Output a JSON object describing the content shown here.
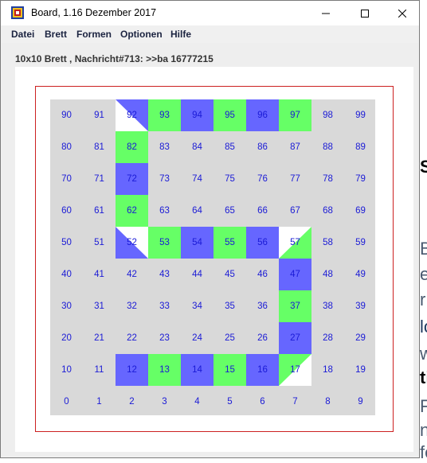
{
  "window": {
    "title": "Board, 1.16 Dezember 2017",
    "controls": {
      "minimize": "minimize",
      "maximize": "maximize",
      "close": "close"
    }
  },
  "menu": [
    "Datei",
    "Brett",
    "Formen",
    "Optionen",
    "Hilfe"
  ],
  "message": "10x10 Brett , Nachricht#713: >>ba 16777215",
  "board": {
    "size": 10,
    "colors": {
      "base": "#d9d9d9",
      "green": "#66ff66",
      "blue": "#6666ff",
      "white": "#ffffff",
      "frame": "#cc2020",
      "number": "#1a1ad6"
    },
    "fills": {
      "82": "green",
      "72": "blue",
      "62": "green",
      "93": "green",
      "94": "blue",
      "95": "green",
      "96": "blue",
      "97": "green",
      "53": "green",
      "54": "blue",
      "55": "green",
      "56": "blue",
      "47": "blue",
      "37": "green",
      "27": "blue",
      "12": "blue",
      "13": "green",
      "14": "blue",
      "15": "green",
      "16": "blue"
    },
    "triangles": {
      "92": {
        "color": "blue",
        "corner": "tr"
      },
      "52": {
        "color": "blue",
        "corner": "bl"
      },
      "57": {
        "color": "green",
        "corner": "br"
      },
      "17": {
        "color": "green",
        "corner": "tl"
      }
    }
  },
  "background_fragments": [
    "S",
    "B",
    "e",
    "r",
    "lo",
    "w",
    "ti",
    "F",
    "n",
    "fe",
    "re"
  ]
}
